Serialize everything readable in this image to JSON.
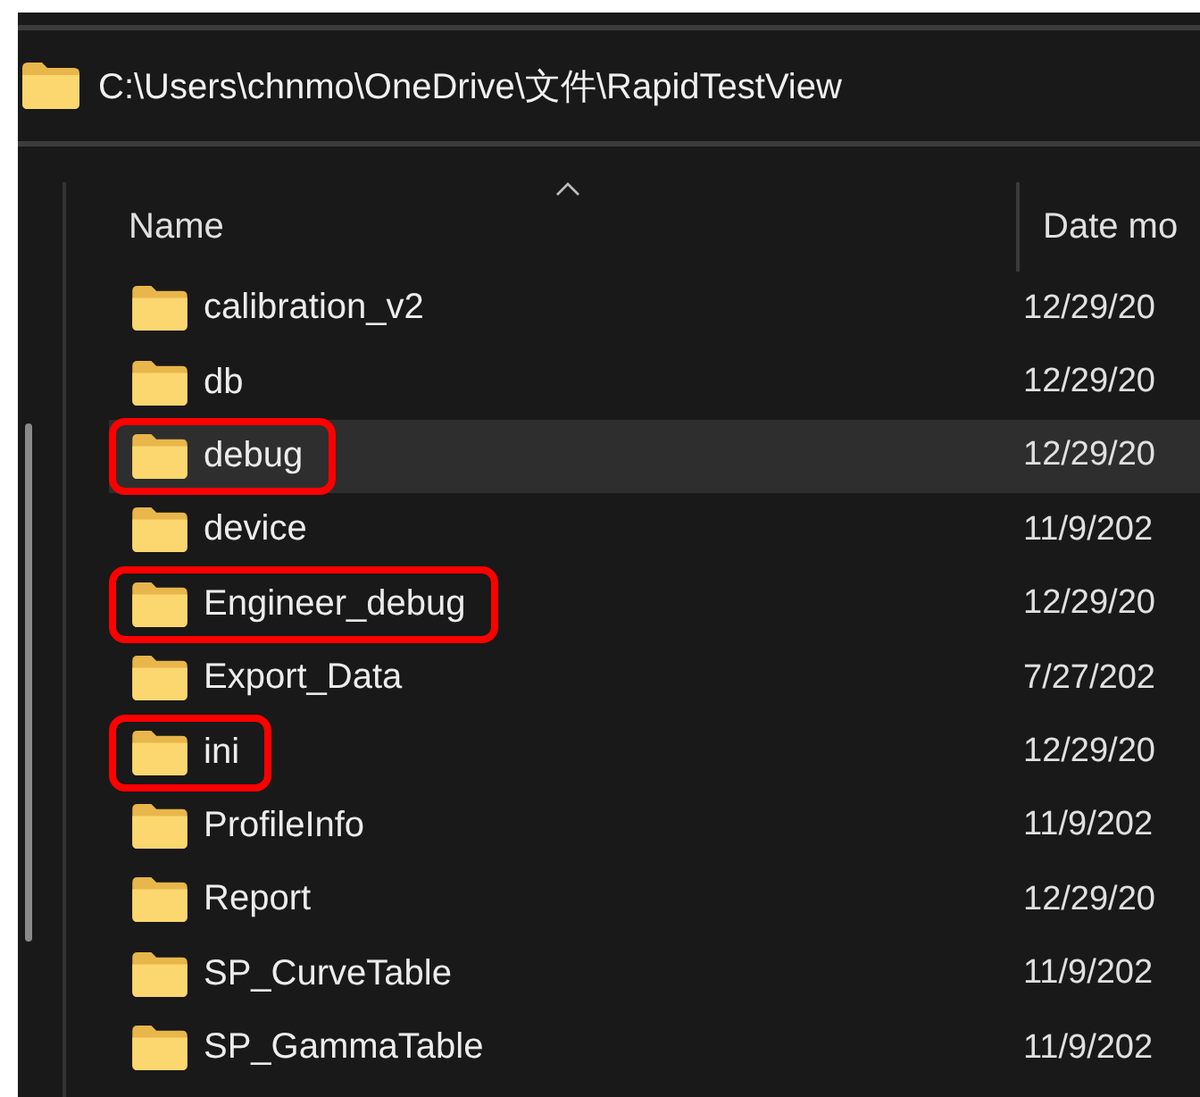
{
  "address_bar": {
    "path": "C:\\Users\\chnmo\\OneDrive\\文件\\RapidTestView"
  },
  "columns": [
    {
      "label": "Name",
      "sorted": true
    },
    {
      "label": "Date mo",
      "sorted": false
    }
  ],
  "rows": [
    {
      "name": "calibration_v2",
      "date": "12/29/20",
      "selected": false,
      "annotated": false
    },
    {
      "name": "db",
      "date": "12/29/20",
      "selected": false,
      "annotated": false
    },
    {
      "name": "debug",
      "date": "12/29/20",
      "selected": true,
      "annotated": true
    },
    {
      "name": "device",
      "date": "11/9/202",
      "selected": false,
      "annotated": false
    },
    {
      "name": "Engineer_debug",
      "date": "12/29/20",
      "selected": false,
      "annotated": true
    },
    {
      "name": "Export_Data",
      "date": "7/27/202",
      "selected": false,
      "annotated": false
    },
    {
      "name": "ini",
      "date": "12/29/20",
      "selected": false,
      "annotated": true
    },
    {
      "name": "ProfileInfo",
      "date": "11/9/202",
      "selected": false,
      "annotated": false
    },
    {
      "name": "Report",
      "date": "12/29/20",
      "selected": false,
      "annotated": false
    },
    {
      "name": "SP_CurveTable",
      "date": "11/9/202",
      "selected": false,
      "annotated": false
    },
    {
      "name": "SP_GammaTable",
      "date": "11/9/202",
      "selected": false,
      "annotated": false
    }
  ]
}
